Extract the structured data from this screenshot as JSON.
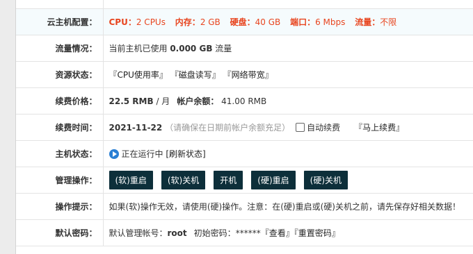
{
  "row_config": {
    "label": "云主机配置：",
    "cpu_label": "CPU：",
    "cpu": "2 CPUs",
    "mem_label": "内存：",
    "mem": "2 GB",
    "disk_label": "硬盘：",
    "disk": "40 GB",
    "port_label": "端口：",
    "port": "6 Mbps",
    "traffic_label": "流量：",
    "traffic": "不限"
  },
  "row_traffic": {
    "label": "流量情况：",
    "prefix": "当前主机已使用 ",
    "used": "0.000 GB",
    "suffix": " 流量"
  },
  "row_resources": {
    "label": "资源状态：",
    "links": [
      "『CPU使用率』",
      "『磁盘读写』",
      "『网络带宽』"
    ]
  },
  "row_price": {
    "label": "续费价格：",
    "price": "22.5 RMB",
    "unit": " / 月",
    "balance_label": "帐户余额：",
    "balance": "41.00 RMB"
  },
  "row_renew": {
    "label": "续费时间：",
    "date": "2021-11-22",
    "note": "（请确保在日期前帐户余额充足）",
    "auto_label": "自动续费",
    "renew_link": "『马上续费』"
  },
  "row_status": {
    "label": "主机状态：",
    "status": "正在运行中",
    "refresh": "[刷新状态]"
  },
  "row_ops": {
    "label": "管理操作：",
    "buttons": [
      "(软)重启",
      "(软)关机",
      "开机",
      "(硬)重启",
      "(硬)关机"
    ]
  },
  "row_tip": {
    "label": "操作提示：",
    "text": "如果(软)操作无效，请使用(硬)操作。注意：在(硬)重启或(硬)关机之前，请先保存好相关数据！"
  },
  "row_pwd": {
    "label": "默认密码：",
    "user_label": "默认管理帐号：",
    "user": "root",
    "pwd_label": "初始密码：",
    "pwd": "******",
    "view": "『查看』",
    "reset": "『重置密码』"
  }
}
